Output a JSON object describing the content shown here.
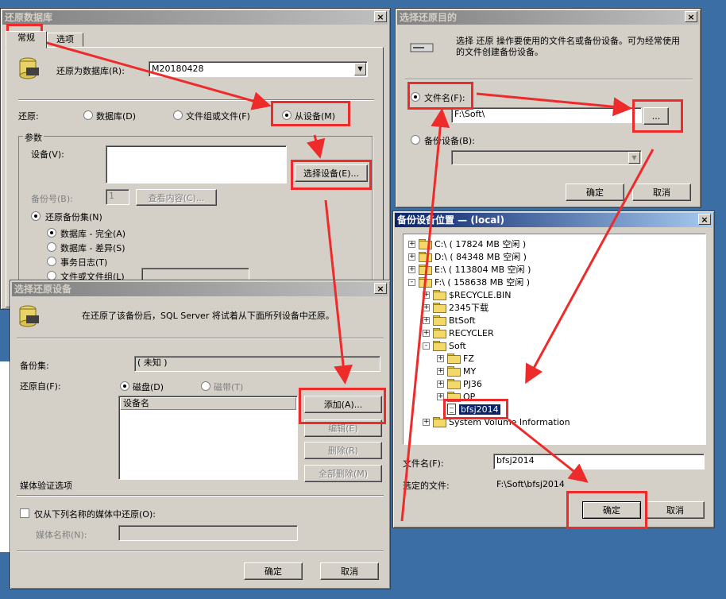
{
  "restore_db": {
    "title": "还原数据库",
    "tabs": [
      "常规",
      "选项"
    ],
    "restore_as_label": "还原为数据库(R):",
    "restore_as_value": "M20180428",
    "restore_label": "还原:",
    "radio_database": "数据库(D)",
    "radio_filegroup": "文件组或文件(F)",
    "radio_device": "从设备(M)",
    "params_label": "参数",
    "device_label": "设备(V):",
    "select_device_btn": "选择设备(E)...",
    "backup_no_label": "备份号(B):",
    "backup_no_value": "1",
    "view_contents_btn": "查看内容(C)...",
    "restore_backupset": "还原备份集(N)",
    "opt_full": "数据库 - 完全(A)",
    "opt_diff": "数据库 - 差异(S)",
    "opt_log": "事务日志(T)",
    "opt_filegroup": "文件或文件组(L)"
  },
  "select_device": {
    "title": "选择还原设备",
    "info": "在还原了该备份后，SQL Server 将试着从下面所列设备中还原。",
    "backupset_label": "备份集:",
    "backupset_value": "( 未知 )",
    "restore_from_label": "还原自(F):",
    "radio_disk": "磁盘(D)",
    "radio_tape": "磁带(T)",
    "column_header": "设备名",
    "add_btn": "添加(A)...",
    "edit_btn": "编辑(E)",
    "delete_btn": "删除(R)",
    "delete_all_btn": "全部删除(M)",
    "media_verify": "媒体验证选项",
    "only_media_check": "仅从下列名称的媒体中还原(O):",
    "media_name_label": "媒体名称(N):",
    "ok": "确定",
    "cancel": "取消"
  },
  "select_dest": {
    "title": "选择还原目的",
    "info": "选择 还原 操作要使用的文件名或备份设备。可为经常使用的文件创建备份设备。",
    "radio_filename": "文件名(F):",
    "filename_value": "F:\\Soft\\",
    "browse_btn": "...",
    "radio_backup_device": "备份设备(B):",
    "ok": "确定",
    "cancel": "取消"
  },
  "backup_location": {
    "title": "备份设备位置 — (local)",
    "tree": [
      {
        "label": "C:\\ ( 17824 MB 空闲 )",
        "kind": "drive",
        "level": 0,
        "pm": "+"
      },
      {
        "label": "D:\\ ( 84348 MB 空闲 )",
        "kind": "drive",
        "level": 0,
        "pm": "+"
      },
      {
        "label": "E:\\ ( 113804 MB 空闲 )",
        "kind": "drive",
        "level": 0,
        "pm": "+"
      },
      {
        "label": "F:\\ ( 158638 MB 空闲 )",
        "kind": "drive",
        "level": 0,
        "pm": "-"
      },
      {
        "label": "$RECYCLE.BIN",
        "kind": "folder",
        "level": 1,
        "pm": "+"
      },
      {
        "label": "2345下载",
        "kind": "folder",
        "level": 1,
        "pm": "+"
      },
      {
        "label": "BtSoft",
        "kind": "folder",
        "level": 1,
        "pm": "+"
      },
      {
        "label": "RECYCLER",
        "kind": "folder",
        "level": 1,
        "pm": "+"
      },
      {
        "label": "Soft",
        "kind": "folder",
        "level": 1,
        "pm": "-"
      },
      {
        "label": "FZ",
        "kind": "folder",
        "level": 2,
        "pm": "+"
      },
      {
        "label": "MY",
        "kind": "folder",
        "level": 2,
        "pm": "+"
      },
      {
        "label": "PJ36",
        "kind": "folder",
        "level": 2,
        "pm": "+"
      },
      {
        "label": "QP",
        "kind": "folder",
        "level": 2,
        "pm": "+"
      },
      {
        "label": "bfsj2014",
        "kind": "file",
        "level": 2,
        "pm": ""
      },
      {
        "label": "System Volume Information",
        "kind": "folder",
        "level": 1,
        "pm": "+"
      }
    ],
    "filename_label": "文件名(F):",
    "filename_value": "bfsj2014",
    "selected_label": "选定的文件:",
    "selected_value": "F:\\Soft\\bfsj2014",
    "ok": "确定",
    "cancel": "取消"
  },
  "colors": {
    "highlight": "#ee2b2b",
    "desktop": "#3a6ea5",
    "face": "#d4d0c8"
  }
}
